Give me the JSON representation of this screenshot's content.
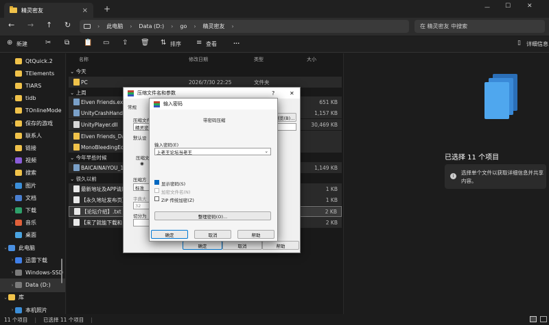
{
  "tab": {
    "title": "精灵密友",
    "close": "×",
    "new": "+"
  },
  "window": {
    "minimize": "—",
    "maximize": "☐",
    "close": "✕"
  },
  "nav": {
    "crumbs": [
      "此电脑",
      "Data (D:)",
      "go",
      "精灵密友"
    ],
    "sep": "›",
    "search_placeholder": "在 精灵密友 中搜索"
  },
  "toolbar": {
    "new": "新建",
    "sort": "排序",
    "view": "查看",
    "more": "···",
    "details": "详细信息"
  },
  "sidebar": [
    {
      "label": "QtQuick.2",
      "indent": 2,
      "type": "folder",
      "chev": ""
    },
    {
      "label": "TElements",
      "indent": 2,
      "type": "folder",
      "chev": ""
    },
    {
      "label": "TIARS",
      "indent": 2,
      "type": "folder",
      "chev": ""
    },
    {
      "label": "tidb",
      "indent": 2,
      "type": "folder",
      "chev": "›"
    },
    {
      "label": "TOnlineMode",
      "indent": 2,
      "type": "folder",
      "chev": ""
    },
    {
      "label": "保存的游戏",
      "indent": 2,
      "type": "folder",
      "chev": "›"
    },
    {
      "label": "联系人",
      "indent": 2,
      "type": "folder",
      "chev": ""
    },
    {
      "label": "链接",
      "indent": 2,
      "type": "folder",
      "chev": ""
    },
    {
      "label": "视频",
      "indent": 2,
      "type": "video",
      "chev": "›"
    },
    {
      "label": "搜索",
      "indent": 2,
      "type": "folder",
      "chev": ""
    },
    {
      "label": "图片",
      "indent": 2,
      "type": "pic",
      "chev": "›"
    },
    {
      "label": "文档",
      "indent": 2,
      "type": "doc",
      "chev": "›"
    },
    {
      "label": "下载",
      "indent": 2,
      "type": "down",
      "chev": "›"
    },
    {
      "label": "音乐",
      "indent": 2,
      "type": "music",
      "chev": "›"
    },
    {
      "label": "桌面",
      "indent": 2,
      "type": "desk",
      "chev": ""
    },
    {
      "label": "此电脑",
      "indent": 1,
      "type": "pc",
      "chev": "⌄"
    },
    {
      "label": "迅雷下载",
      "indent": 2,
      "type": "xl",
      "chev": "›"
    },
    {
      "label": "Windows-SSD",
      "indent": 2,
      "type": "drive",
      "chev": "›"
    },
    {
      "label": "Data (D:)",
      "indent": 2,
      "type": "drive",
      "chev": "›",
      "selected": true
    },
    {
      "label": "库",
      "indent": 1,
      "type": "folder",
      "chev": "⌄"
    },
    {
      "label": "本机照片",
      "indent": 2,
      "type": "pic",
      "chev": "›"
    }
  ],
  "columns": {
    "name": "名称",
    "date": "修改日期",
    "type": "类型",
    "size": "大小"
  },
  "groups": {
    "today": "今天",
    "lastweek": "上周",
    "earlier_year": "今年早些时候",
    "long_ago": "很久以前"
  },
  "rows": [
    {
      "name": "PC",
      "date": "2026/7/30 22:25",
      "type": "文件夹",
      "size": "",
      "icon": "folder",
      "group": "today"
    },
    {
      "name": "Elven Friends.exe",
      "date": "",
      "type": "",
      "size": "651 KB",
      "icon": "exe"
    },
    {
      "name": "UnityCrashHandler",
      "date": "",
      "type": "",
      "size": "1,157 KB",
      "icon": "exe"
    },
    {
      "name": "UnityPlayer.dll",
      "date": "",
      "type": "",
      "size": "30,469 KB",
      "icon": "dll"
    },
    {
      "name": "Elven Friends_Data",
      "date": "",
      "type": "",
      "size": "",
      "icon": "folder"
    },
    {
      "name": "MonoBleedingEdge",
      "date": "",
      "type": "",
      "size": "",
      "icon": "folder"
    },
    {
      "name": "BAICAINAIYOU_1",
      "date": "",
      "type": "",
      "size": "1,149 KB",
      "icon": "exe"
    },
    {
      "name": "最新地址及APP请加",
      "date": "",
      "type": "",
      "size": "1 KB",
      "icon": "txt"
    },
    {
      "name": "【永久地址发布页】",
      "date": "",
      "type": "",
      "size": "1 KB",
      "icon": "txt"
    },
    {
      "name": "【论坛介绍】.txt",
      "date": "",
      "type": "",
      "size": "2 KB",
      "icon": "txt",
      "selected": true
    },
    {
      "name": "【来了就能下载和",
      "date": "",
      "type": "",
      "size": "2 KB",
      "icon": "txt"
    }
  ],
  "detail": {
    "selected": "已选择 11 个项目",
    "hint": "选择单个文件以获取详细信息并共享内容。"
  },
  "status": {
    "count": "11 个项目",
    "selected": "已选择 11 个项目"
  },
  "dlg1": {
    "title": "压缩文件名和参数",
    "help": "?",
    "close": "✕",
    "tab_general": "常规",
    "archive_label": "压缩文件",
    "archive_value": "精灵密",
    "browse": "浏览(B)...",
    "default_label": "默认设",
    "format_label": "压缩文",
    "method_label": "压缩方",
    "method_value": "标准",
    "dict_label": "字典大",
    "dict_value": "32",
    "split_label": "切分为",
    "ok": "确定",
    "cancel": "取消",
    "helpbtn": "帮助"
  },
  "dlg2": {
    "title": "输入密码",
    "subtitle": "带密码压缩",
    "enter_label": "输入密码(E)",
    "password": "上老王论坛当老王",
    "show": "显示密码(S)",
    "encrypt_names": "加密文件名(N)",
    "zip_legacy": "ZIP 传统加密(Z)",
    "organize": "整理密码(O)...",
    "ok": "确定",
    "cancel": "取消",
    "help": "帮助"
  },
  "colors": {
    "accent": "#0078d4",
    "folder": "#f0c24a",
    "selection": "#3a3a3a"
  }
}
